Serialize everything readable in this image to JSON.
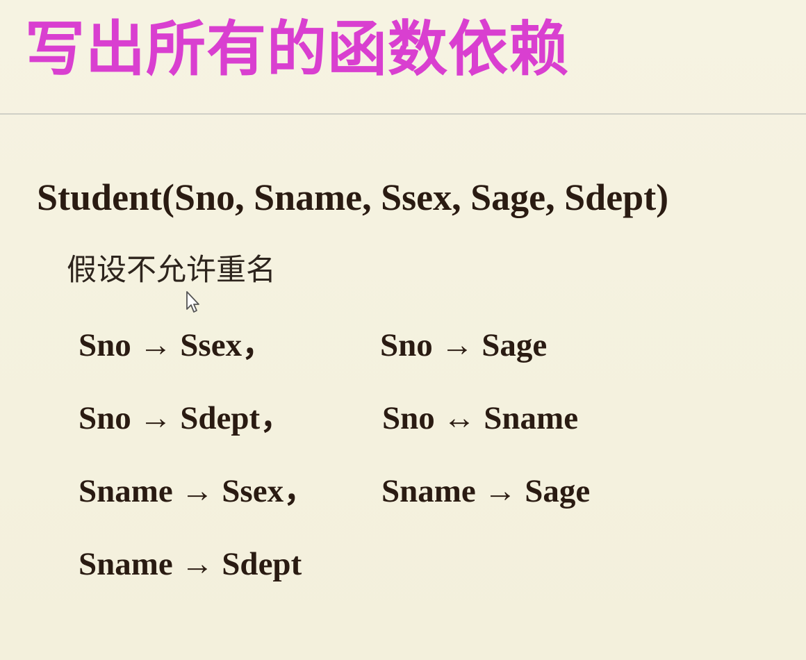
{
  "title": "写出所有的函数依赖",
  "relation": "Student(Sno, Sname, Ssex, Sage, Sdept)",
  "assumption": "假设不允许重名",
  "dependencies": [
    "Sno → Ssex，",
    "Sno → Sage",
    "Sno → Sdept，",
    "Sno ↔ Sname",
    "Sname → Ssex，",
    "Sname → Sage",
    "Sname → Sdept"
  ],
  "icons": {
    "cursor": "mouse-pointer-icon"
  },
  "colors": {
    "background": "#f5f2df",
    "title": "#d93fd0",
    "text": "#2a1b12",
    "divider": "#cfcfc6"
  }
}
